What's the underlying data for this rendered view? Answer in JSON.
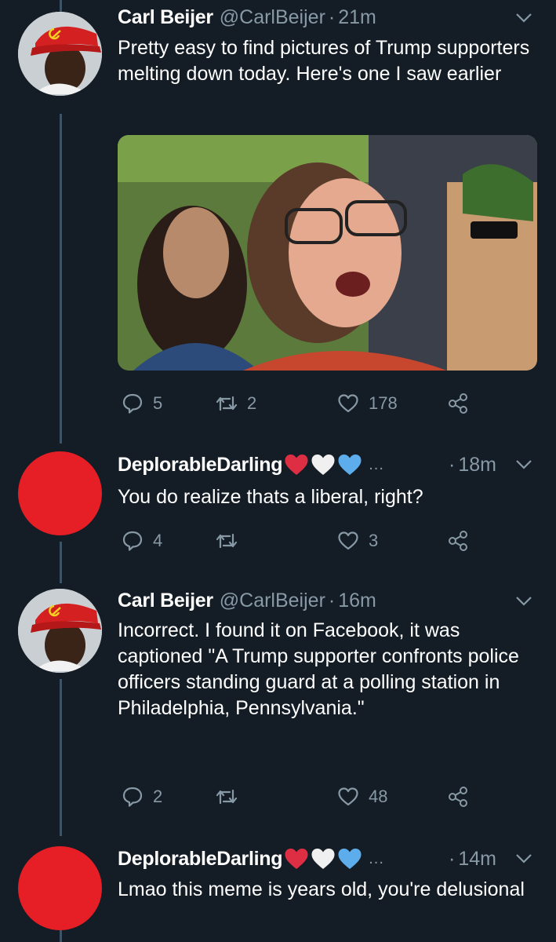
{
  "colors": {
    "background": "#141d26",
    "muted": "#8899a6",
    "thread_line": "#3d5466",
    "avatar_red": "#e61e25"
  },
  "tweets": [
    {
      "author": "Carl Beijer",
      "handle": "@CarlBeijer",
      "separator": "·",
      "time": "21m",
      "avatar": "photo",
      "text": "Pretty easy to find pictures of Trump supporters melting down today. Here's one I saw earlier",
      "has_media": true,
      "replies": "5",
      "retweets": "2",
      "likes": "178"
    },
    {
      "author": "DeplorableDarling",
      "emoji": [
        "red-heart",
        "white-heart",
        "blue-heart"
      ],
      "ellipsis": "...",
      "separator": "·",
      "time": "18m",
      "avatar": "red-circle",
      "text": "You do realize thats a liberal, right?",
      "replies": "4",
      "retweets": "",
      "likes": "3"
    },
    {
      "author": "Carl Beijer",
      "handle": "@CarlBeijer",
      "separator": "·",
      "time": "16m",
      "avatar": "photo",
      "text": "Incorrect. I found it on Facebook, it was captioned \"A Trump supporter confronts police officers standing guard at a polling station in Philadelphia, Pennsylvania.\"",
      "replies": "2",
      "retweets": "",
      "likes": "48"
    },
    {
      "author": "DeplorableDarling",
      "emoji": [
        "red-heart",
        "white-heart",
        "blue-heart"
      ],
      "ellipsis": "...",
      "separator": "·",
      "time": "14m",
      "avatar": "red-circle",
      "text": "Lmao this meme is years old, you're delusional"
    }
  ]
}
